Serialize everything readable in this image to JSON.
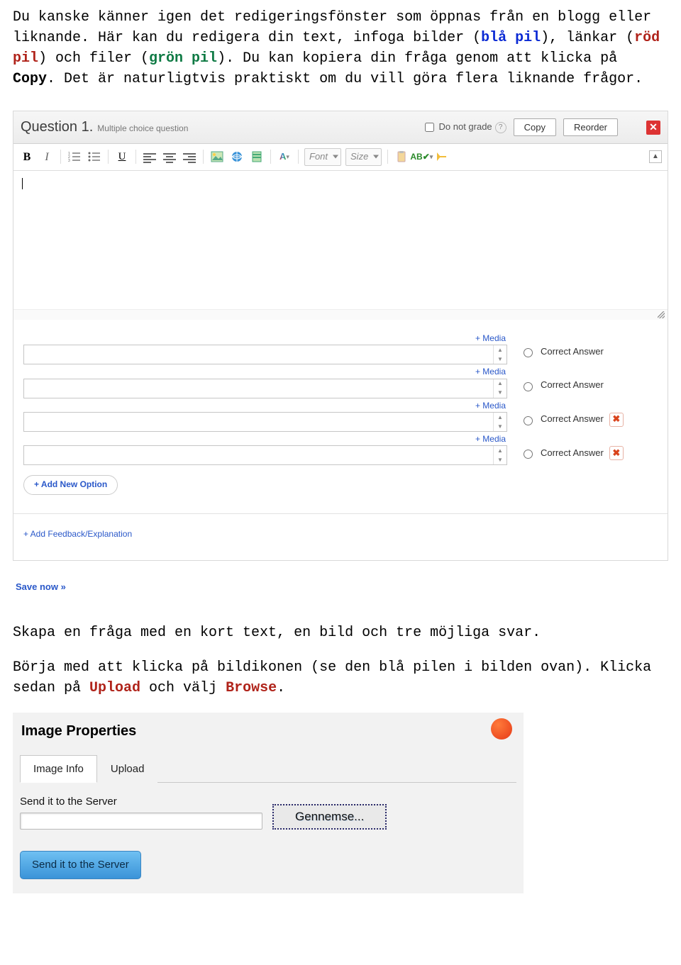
{
  "intro": {
    "t1": "Du kanske känner igen det redigeringsfönster som öppnas från en blogg eller liknande. Här kan du redigera din text, infoga bilder (",
    "blue": "blå pil",
    "t2": "), länkar (",
    "red": "röd pil",
    "t3": ") och filer (",
    "green": "grön pil",
    "t4": "). Du kan kopiera din fråga genom att klicka på ",
    "copy": "Copy",
    "t5": ". Det är naturligtvis praktiskt om du vill göra flera liknande frågor."
  },
  "editor": {
    "question_label": "Question 1.",
    "question_sub": "Multiple choice question",
    "do_not_grade": "Do not grade",
    "copy_btn": "Copy",
    "reorder_btn": "Reorder",
    "font_label": "Font",
    "size_label": "Size",
    "media_label": "+ Media",
    "correct_label": "Correct Answer",
    "add_option": "+ Add New Option",
    "add_feedback": "+ Add Feedback/Explanation"
  },
  "save_now": "Save now »",
  "para2": "Skapa en fråga med en kort text, en bild och tre möjliga svar.",
  "para3": {
    "t1": "Börja med att klicka på bildikonen (se den blå pilen i bilden ovan). Klicka sedan på ",
    "upload": "Upload",
    "t2": " och välj ",
    "browse": "Browse",
    "t3": "."
  },
  "dialog": {
    "title": "Image Properties",
    "tab_info": "Image Info",
    "tab_upload": "Upload",
    "send_label": "Send it to the Server",
    "browse_btn": "Gennemse...",
    "send_btn": "Send it to the Server"
  }
}
